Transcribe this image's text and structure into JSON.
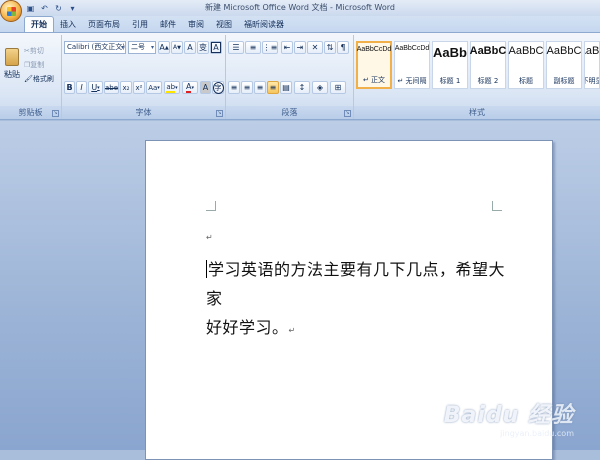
{
  "window": {
    "title": "新建 Microsoft Office Word 文档 - Microsoft Word"
  },
  "quick_access": {
    "save_icon": "save-icon",
    "undo_icon": "undo-icon",
    "redo_icon": "redo-icon",
    "customize_icon": "chevron-down-icon"
  },
  "tabs": [
    "开始",
    "插入",
    "页面布局",
    "引用",
    "邮件",
    "审阅",
    "视图",
    "福昕阅读器"
  ],
  "active_tab": "开始",
  "clipboard": {
    "paste": "粘贴",
    "cut": "剪切",
    "copy": "复制",
    "format_painter": "格式刷",
    "label": "剪贴板"
  },
  "font": {
    "name": "Calibri (西文正文)",
    "size": "二号",
    "grow": "A",
    "shrink": "A",
    "clear": "A",
    "phonetic": "变",
    "border": "A",
    "bold": "B",
    "italic": "I",
    "underline": "U",
    "strikethrough": "abe",
    "subscript": "x₂",
    "superscript": "x²",
    "case": "Aa",
    "highlight": "ab",
    "color": "A",
    "shading": "A",
    "enclose": "字",
    "label": "字体"
  },
  "paragraph": {
    "label": "段落"
  },
  "styles": {
    "label": "样式",
    "items": [
      {
        "sample": "AaBbCcDd",
        "name": "↵ 正文"
      },
      {
        "sample": "AaBbCcDd",
        "name": "↵ 无间隔"
      },
      {
        "sample": "AaBb",
        "name": "标题 1"
      },
      {
        "sample": "AaBbC",
        "name": "标题 2"
      },
      {
        "sample": "AaBbC",
        "name": "标题"
      },
      {
        "sample": "AaBbC",
        "name": "副标题"
      },
      {
        "sample": "AaBb",
        "name": "不明显"
      }
    ]
  },
  "document": {
    "para_mark": "↵",
    "line1": "学习英语的方法主要有几下几点，希望大家",
    "line2": "好好学习。"
  },
  "watermark": {
    "brand": "Baidu 经验",
    "url": "jingyan.baidu.com"
  },
  "colors": {
    "accent": "#f2b04a",
    "ribbon": "#dbe6f5",
    "workspace": "#9bb3d6"
  }
}
